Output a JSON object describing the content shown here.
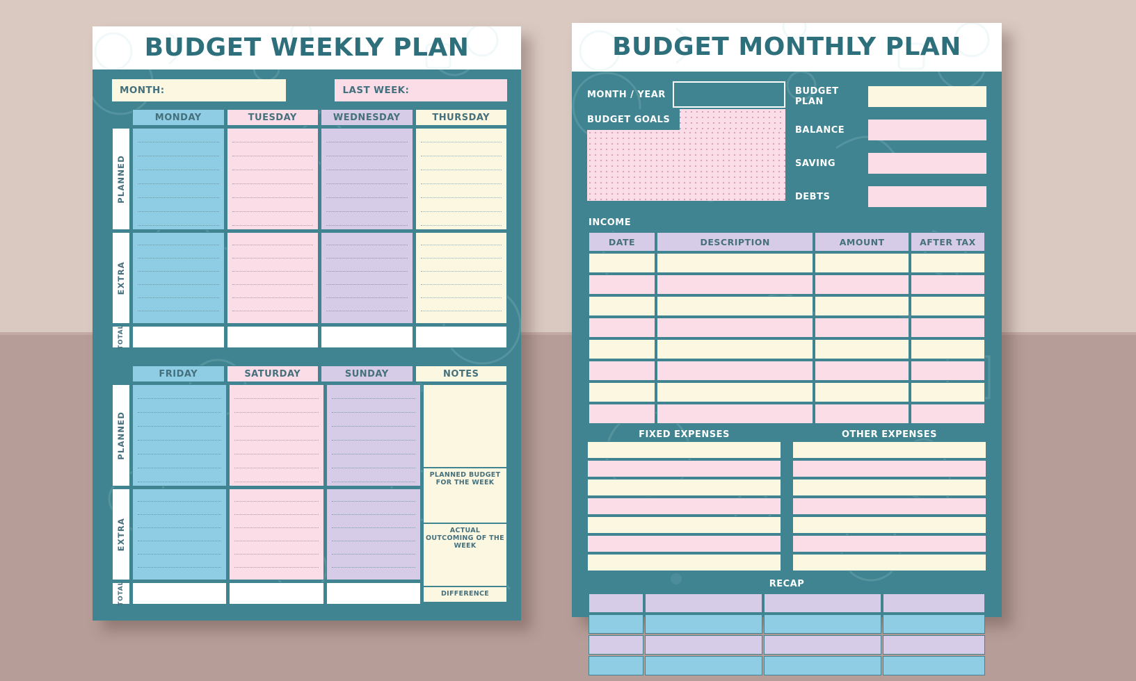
{
  "background": {
    "top_color": "#d9c9c1",
    "bottom_color": "#b69d97"
  },
  "palette": {
    "teal": "#3f8490",
    "cream": "#fcf7e0",
    "pink": "#fbdde8",
    "lavender": "#d6cce8",
    "blue": "#8ecde3",
    "text_teal": "#45707c",
    "white": "#ffffff"
  },
  "weekly": {
    "title": "BUDGET WEEKLY PLAN",
    "fields": [
      {
        "label": "MONTH:",
        "color": "cream"
      },
      {
        "label": "LAST WEEK:",
        "color": "pink"
      }
    ],
    "row_labels": [
      "PLANNED",
      "EXTRA",
      "TOTAL"
    ],
    "block1_days": [
      "MONDAY",
      "TUESDAY",
      "WEDNESDAY",
      "THURSDAY"
    ],
    "block2_days": [
      "FRIDAY",
      "SATURDAY",
      "SUNDAY",
      "NOTES"
    ],
    "notes_captions": [
      "PLANNED BUDGET FOR THE WEEK",
      "ACTUAL OUTCOMING OF THE WEEK",
      "DIFFERENCE"
    ]
  },
  "monthly": {
    "title": "BUDGET MONTHLY PLAN",
    "month_year_label": "MONTH / YEAR",
    "budget_goals_label": "BUDGET GOALS",
    "summary_fields": [
      {
        "label": "BUDGET PLAN",
        "color": "cream"
      },
      {
        "label": "BALANCE",
        "color": "pink"
      },
      {
        "label": "SAVING",
        "color": "pink"
      },
      {
        "label": "DEBTS",
        "color": "pink"
      }
    ],
    "income": {
      "section_label": "INCOME",
      "columns": [
        "DATE",
        "DESCRIPTION",
        "AMOUNT",
        "AFTER TAX"
      ],
      "row_count": 8
    },
    "expenses": {
      "fixed_label": "FIXED EXPENSES",
      "other_label": "OTHER EXPENSES",
      "fixed_row_count": 7,
      "other_row_count": 7
    },
    "recap": {
      "section_label": "RECAP",
      "column_count": 4,
      "row_count": 4
    }
  }
}
